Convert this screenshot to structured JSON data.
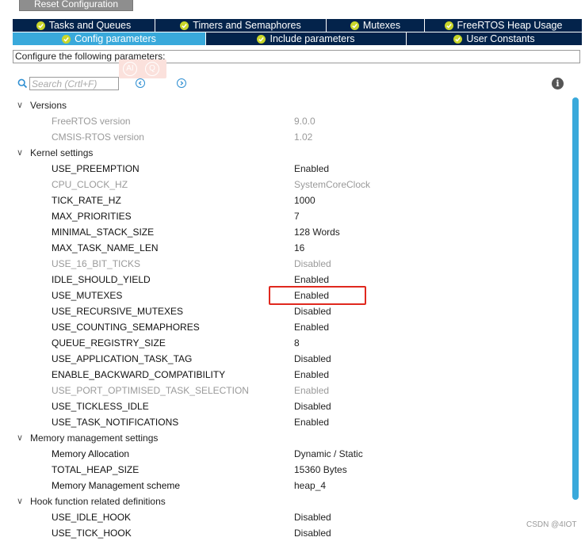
{
  "toolbar": {
    "reset_label": "Reset Configuration"
  },
  "tabs_row1": [
    {
      "label": "Tasks and Queues"
    },
    {
      "label": "Timers and Semaphores"
    },
    {
      "label": "Mutexes"
    },
    {
      "label": "FreeRTOS Heap Usage"
    }
  ],
  "tabs_row2": [
    {
      "label": "Config parameters",
      "active": true
    },
    {
      "label": "Include parameters"
    },
    {
      "label": "User Constants"
    }
  ],
  "description": "Configure the following parameters:",
  "search": {
    "placeholder": "Search (Crtl+F)"
  },
  "ai_badge": {
    "left": "AI",
    "right": "Q"
  },
  "tree": {
    "versions": {
      "label": "Versions",
      "items": [
        {
          "name": "FreeRTOS version",
          "value": "9.0.0"
        },
        {
          "name": "CMSIS-RTOS version",
          "value": "1.02"
        }
      ]
    },
    "kernel": {
      "label": "Kernel settings",
      "items": [
        {
          "name": "USE_PREEMPTION",
          "value": "Enabled"
        },
        {
          "name": "CPU_CLOCK_HZ",
          "value": "SystemCoreClock"
        },
        {
          "name": "TICK_RATE_HZ",
          "value": "1000"
        },
        {
          "name": "MAX_PRIORITIES",
          "value": "7"
        },
        {
          "name": "MINIMAL_STACK_SIZE",
          "value": "128 Words"
        },
        {
          "name": "MAX_TASK_NAME_LEN",
          "value": "16"
        },
        {
          "name": "USE_16_BIT_TICKS",
          "value": "Disabled"
        },
        {
          "name": "IDLE_SHOULD_YIELD",
          "value": "Enabled"
        },
        {
          "name": "USE_MUTEXES",
          "value": "Enabled"
        },
        {
          "name": "USE_RECURSIVE_MUTEXES",
          "value": "Disabled"
        },
        {
          "name": "USE_COUNTING_SEMAPHORES",
          "value": "Enabled"
        },
        {
          "name": "QUEUE_REGISTRY_SIZE",
          "value": "8"
        },
        {
          "name": "USE_APPLICATION_TASK_TAG",
          "value": "Disabled"
        },
        {
          "name": "ENABLE_BACKWARD_COMPATIBILITY",
          "value": "Enabled"
        },
        {
          "name": "USE_PORT_OPTIMISED_TASK_SELECTION",
          "value": "Enabled"
        },
        {
          "name": "USE_TICKLESS_IDLE",
          "value": "Disabled"
        },
        {
          "name": "USE_TASK_NOTIFICATIONS",
          "value": "Enabled"
        }
      ]
    },
    "memory": {
      "label": "Memory management settings",
      "items": [
        {
          "name": "Memory Allocation",
          "value": "Dynamic / Static"
        },
        {
          "name": "TOTAL_HEAP_SIZE",
          "value": "15360 Bytes"
        },
        {
          "name": "Memory Management scheme",
          "value": "heap_4"
        }
      ]
    },
    "hooks": {
      "label": "Hook function related definitions",
      "items": [
        {
          "name": "USE_IDLE_HOOK",
          "value": "Disabled"
        },
        {
          "name": "USE_TICK_HOOK",
          "value": "Disabled"
        }
      ]
    }
  },
  "watermark": "CSDN @4IOT",
  "colors": {
    "tab_bg": "#03234b",
    "tab_active": "#39a9db",
    "check": "#c9d62a",
    "highlight": "#e0281e"
  }
}
